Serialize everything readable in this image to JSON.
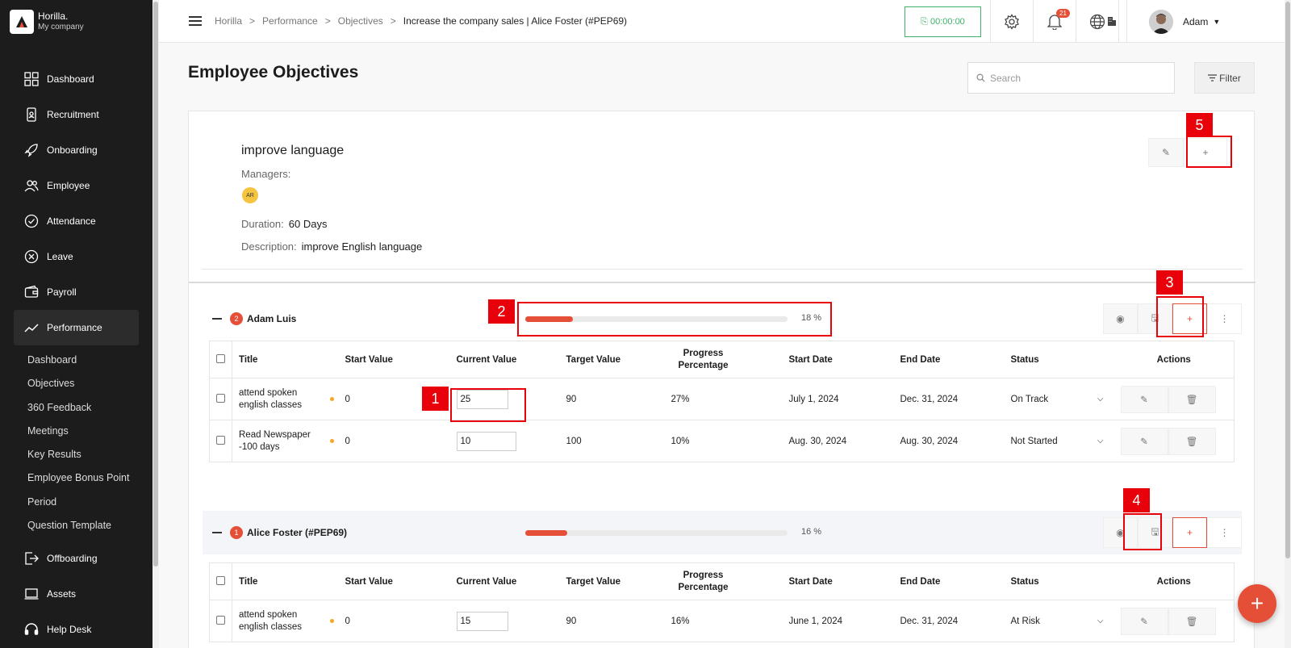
{
  "brand": {
    "name": "Horilla.",
    "sub": "My company"
  },
  "sidebar": {
    "items": [
      {
        "label": "Dashboard",
        "icon": "grid-icon"
      },
      {
        "label": "Recruitment",
        "icon": "id-badge-icon"
      },
      {
        "label": "Onboarding",
        "icon": "rocket-icon"
      },
      {
        "label": "Employee",
        "icon": "users-icon"
      },
      {
        "label": "Attendance",
        "icon": "check-circle-icon"
      },
      {
        "label": "Leave",
        "icon": "x-circle-icon"
      },
      {
        "label": "Payroll",
        "icon": "wallet-icon"
      },
      {
        "label": "Performance",
        "icon": "trend-icon"
      }
    ],
    "sub_items": [
      "Dashboard",
      "Objectives",
      "360 Feedback",
      "Meetings",
      "Key Results",
      "Employee Bonus Point",
      "Period",
      "Question Template"
    ],
    "items_after": [
      {
        "label": "Offboarding",
        "icon": "exit-icon"
      },
      {
        "label": "Assets",
        "icon": "laptop-icon"
      },
      {
        "label": "Help Desk",
        "icon": "headset-icon"
      }
    ]
  },
  "header": {
    "breadcrumb": [
      "Horilla",
      "Performance",
      "Objectives",
      "Increase the company sales | Alice Foster (#PEP69)"
    ],
    "timer": "00:00:00",
    "notifications": "21",
    "user": "Adam"
  },
  "page": {
    "title": "Employee Objectives",
    "search_placeholder": "Search",
    "filter_label": "Filter"
  },
  "objective": {
    "title": "improve language",
    "managers_label": "Managers:",
    "manager_initials": "AR",
    "duration_label": "Duration:",
    "duration": "60 Days",
    "description_label": "Description:",
    "description": "improve English language"
  },
  "table_headers": [
    "Title",
    "Start Value",
    "Current Value",
    "Target Value",
    "Progress Percentage",
    "Start Date",
    "End Date",
    "Status",
    "Actions"
  ],
  "employees": [
    {
      "count": "2",
      "name": "Adam Luis",
      "progress_pct": 18,
      "progress_label": "18 %",
      "rows": [
        {
          "title": "attend spoken english classes",
          "start": "0",
          "current": "25",
          "target": "90",
          "progress": "27%",
          "start_date": "July 1, 2024",
          "end_date": "Dec. 31, 2024",
          "status": "On Track"
        },
        {
          "title": "Read Newspaper -100 days",
          "start": "0",
          "current": "10",
          "target": "100",
          "progress": "10%",
          "start_date": "Aug. 30, 2024",
          "end_date": "Aug. 30, 2024",
          "status": "Not Started"
        }
      ]
    },
    {
      "count": "1",
      "name": "Alice Foster (#PEP69)",
      "progress_pct": 16,
      "progress_label": "16 %",
      "rows": [
        {
          "title": "attend spoken english classes",
          "start": "0",
          "current": "15",
          "target": "90",
          "progress": "16%",
          "start_date": "June 1, 2024",
          "end_date": "Dec. 31, 2024",
          "status": "At Risk"
        }
      ]
    }
  ],
  "annotations": [
    "1",
    "2",
    "3",
    "4",
    "5"
  ],
  "colors": {
    "accent": "#e54f38",
    "timer": "#3eb26a",
    "annotation": "#e8000b"
  }
}
